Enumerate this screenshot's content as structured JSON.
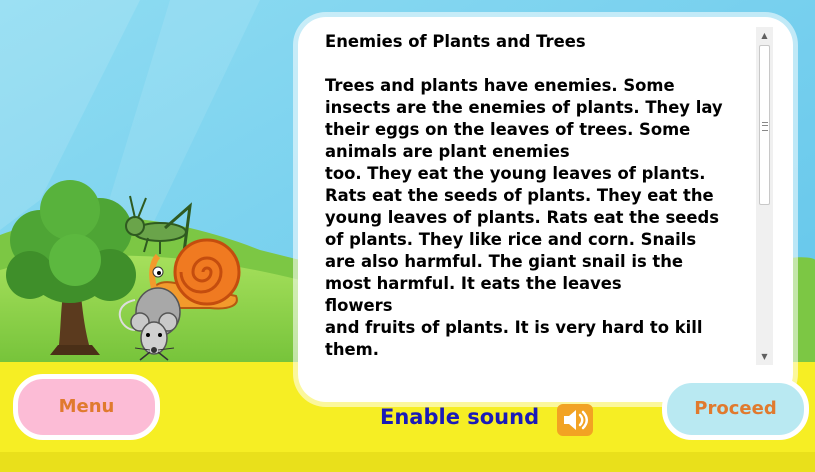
{
  "passage": {
    "title": "Enemies of Plants and Trees",
    "body": "Trees and plants have enemies. Some\ninsects are the enemies of plants. They lay\ntheir eggs on the leaves of trees. Some\nanimals are plant enemies\ntoo. They eat the young leaves of plants.\nRats eat the seeds of plants. They eat the\nyoung leaves of plants. Rats eat the seeds\nof plants. They like rice and corn. Snails\nare also harmful. The giant snail is the\nmost harmful. It eats the leaves\nflowers\nand fruits of plants. It is very hard to kill\nthem."
  },
  "buttons": {
    "menu": "Menu",
    "proceed": "Proceed"
  },
  "sound": {
    "label": "Enable sound",
    "icon": "speaker-icon"
  },
  "colors": {
    "sky": "#7fd3ef",
    "grass": "#8ed24a",
    "ground": "#f6ee24",
    "menu_button": "#fcbcd6",
    "proceed_button": "#b9e9f2",
    "button_text": "#e07a2e",
    "sound_label": "#1a1ab8",
    "sound_icon": "#f2a323"
  }
}
